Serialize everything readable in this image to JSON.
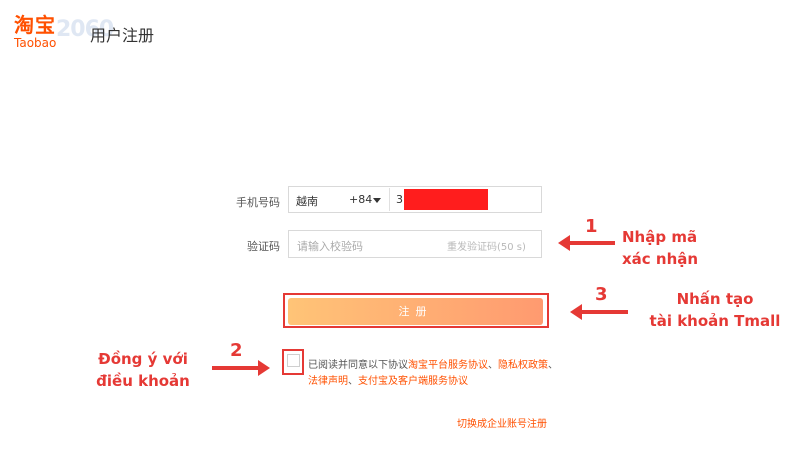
{
  "header": {
    "logo_cn": "淘宝",
    "logo_en": "Taobao",
    "logo_watermark": "2060",
    "title": "用户注册"
  },
  "form": {
    "phone_label": "手机号码",
    "country": "越南",
    "country_code": "+84",
    "phone_value": "3",
    "code_label": "验证码",
    "code_placeholder": "请输入校验码",
    "resend_label": "重发验证码(50 s)",
    "register_button": "注册",
    "agree_prefix": "已阅读并同意以下协议",
    "agreements": [
      "淘宝平台服务协议",
      "隐私权政策",
      "法律声明",
      "支付宝及客户端服务协议"
    ],
    "separator": "、",
    "enterprise_link": "切换成企业账号注册"
  },
  "annotations": [
    {
      "num": "1",
      "text_line1": "Nhập mã",
      "text_line2": "xác nhận"
    },
    {
      "num": "2",
      "text_line1": "Đồng ý với",
      "text_line2": "điều khoản"
    },
    {
      "num": "3",
      "text_line1": "Nhấn tạo",
      "text_line2": "tài khoản Tmall"
    }
  ],
  "colors": {
    "brand": "#ff5000",
    "annotation": "#e53935",
    "button_gradient_start": "#ffc477",
    "button_gradient_end": "#ff9a70"
  }
}
